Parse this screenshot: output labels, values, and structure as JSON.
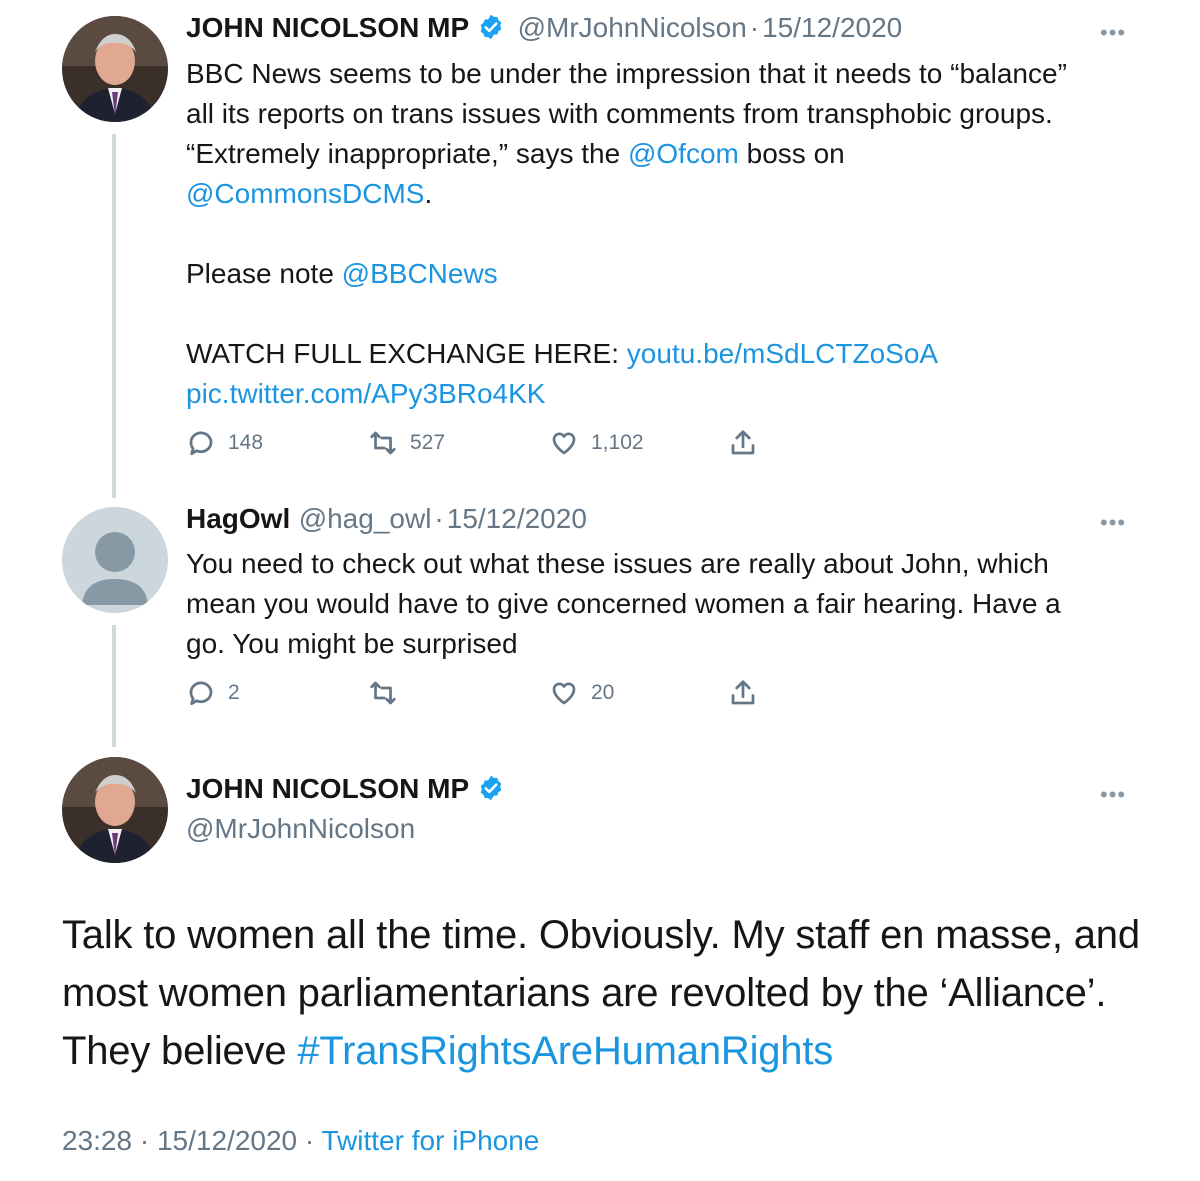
{
  "tweet1": {
    "name": "JOHN NICOLSON MP",
    "handle": "@MrJohnNicolson",
    "sep": "·",
    "date": "15/12/2020",
    "more": "•••",
    "line1": "BBC News seems to be under the impression that it needs to “balance”",
    "line2": "all its reports on trans issues with comments from transphobic groups.",
    "line3_pre": "“Extremely inappropriate,” says the ",
    "line3_link": "@Ofcom",
    "line3_post": " boss on",
    "line4_link": "@CommonsDCMS",
    "line4_post": ".",
    "line5_pre": "Please note ",
    "line5_link": "@BBCNews",
    "line6_pre": "WATCH FULL EXCHANGE HERE: ",
    "line6_link": "youtu.be/mSdLCTZoSoA",
    "line7_link": "pic.twitter.com/APy3BRo4KK",
    "replies": "148",
    "retweets": "527",
    "likes": "1,102"
  },
  "tweet2": {
    "name": "HagOwl",
    "handle": "@hag_owl",
    "sep": "·",
    "date": "15/12/2020",
    "more": "•••",
    "line1": "You need to check out what these issues are really about John, which",
    "line2": "mean you would have to give concerned women a fair hearing. Have a",
    "line3": "go. You might be surprised",
    "replies": "2",
    "likes": "20"
  },
  "tweet3": {
    "name": "JOHN NICOLSON MP",
    "handle": "@MrJohnNicolson",
    "more": "•••",
    "line1": "Talk to women all the time. Obviously. My staff en masse, and",
    "line2": "most women parliamentarians are revolted by the ‘Alliance’.",
    "line3_pre": "They believe ",
    "line3_link": "#TransRightsAreHumanRights",
    "time": "23:28",
    "sep1": "·",
    "date": "15/12/2020",
    "sep2": "·",
    "source": "Twitter for iPhone"
  },
  "colors": {
    "link": "#1b95e0",
    "muted": "#657786",
    "verified": "#1da1f2",
    "thread": "#cfd9de"
  },
  "icons": [
    "reply-icon",
    "retweet-icon",
    "like-icon",
    "share-icon",
    "verified-badge-icon",
    "more-icon"
  ]
}
